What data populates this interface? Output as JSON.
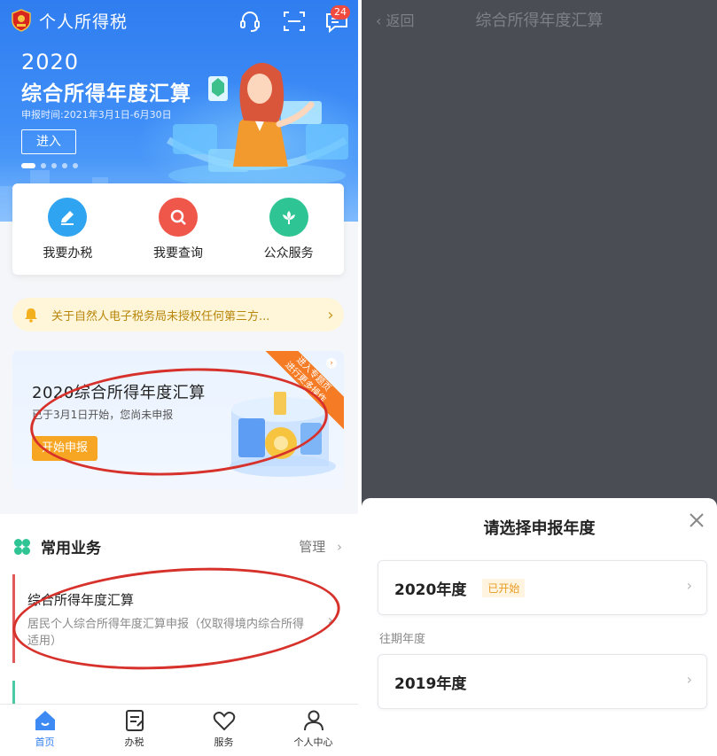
{
  "left": {
    "header": {
      "app_title": "个人所得税",
      "badge_count": "24",
      "icons": [
        "emblem-icon",
        "headset-icon",
        "scan-icon",
        "message-icon"
      ]
    },
    "banner": {
      "year": "2020",
      "title": "综合所得年度汇算",
      "date_range": "申报时间:2021年3月1日-6月30日",
      "enter_label": "进入",
      "slide_count": 5,
      "active_slide": 1
    },
    "quick_actions": [
      {
        "label": "我要办税",
        "icon": "edit-icon",
        "color": "#2fa4f0"
      },
      {
        "label": "我要查询",
        "icon": "search-icon",
        "color": "#f0574b"
      },
      {
        "label": "公众服务",
        "icon": "flower-icon",
        "color": "#2fc493"
      }
    ],
    "notice": {
      "text": "关于自然人电子税务局未授权任何第三方...",
      "icon": "bell-icon"
    },
    "promo": {
      "title": "2020综合所得年度汇算",
      "subtitle": "已于3月1日开始，您尚未申报",
      "button": "开始申报",
      "ribbon_line1": "进入专题页",
      "ribbon_line2": "进行更多操作"
    },
    "common_business": {
      "title": "常用业务",
      "manage_label": "管理",
      "item_title": "综合所得年度汇算",
      "item_desc": "居民个人综合所得年度汇算申报（仅取得境内综合所得适用）"
    },
    "tabs": [
      {
        "label": "首页",
        "icon": "home-icon",
        "active": true
      },
      {
        "label": "办税",
        "icon": "document-icon",
        "active": false
      },
      {
        "label": "服务",
        "icon": "heart-icon",
        "active": false
      },
      {
        "label": "个人中心",
        "icon": "person-icon",
        "active": false
      }
    ]
  },
  "right": {
    "nav": {
      "back_label": "返回",
      "title": "综合所得年度汇算"
    },
    "sheet": {
      "title": "请选择申报年度",
      "years": [
        {
          "label": "2020年度",
          "tag": "已开始"
        },
        {
          "label": "2019年度",
          "tag": ""
        }
      ],
      "past_label": "往期年度"
    }
  },
  "colors": {
    "brand_blue": "#2f7df0",
    "annotation_red": "#d7312b",
    "promo_button": "#f6a623",
    "overlay": "#4a4d53"
  }
}
